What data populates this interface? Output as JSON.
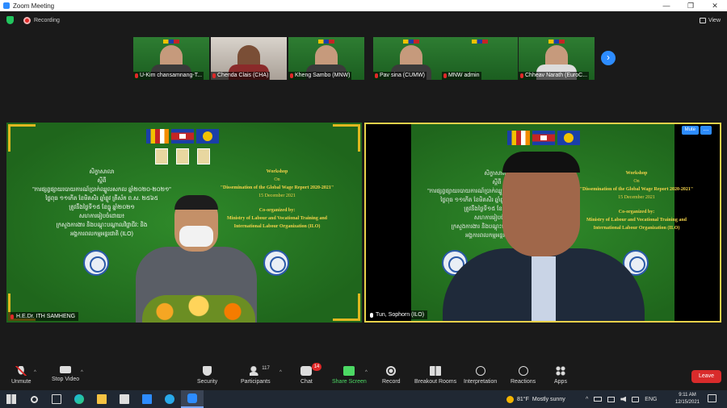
{
  "window": {
    "title": "Zoom Meeting",
    "controls": [
      "—",
      "❐",
      "✕"
    ]
  },
  "status": {
    "recording_label": "Recording",
    "view_label": "View"
  },
  "thumbnails": [
    {
      "name": "U-Kim chansamnang-T..."
    },
    {
      "name": "Chenda Clais (CHA)"
    },
    {
      "name": "Kheng Sambo (MNW)"
    },
    {
      "name": "Pav sina (CUMW)"
    },
    {
      "name": "MNW admin"
    },
    {
      "name": "Chheav Narath (EuroC..."
    }
  ],
  "next_page_arrow": "›",
  "slide": {
    "kh_lines": [
      "សិក្ខាសាលា",
      "ស្ដីពី",
      "\"ការផ្សព្វផ្សាយរបាយការណ៍ប្រាក់ឈ្នួលសកល ឆ្នាំ២០២០-២០២១\"",
      "ថ្ងៃពុធ ១១កើត ខែមិគសិរ ឆ្នាំឆ្លូវ ត្រីស័ក ព.ស. ២៥៦៥",
      "ត្រូវនឹងថ្ងៃទី១៥ ខែធ្នូ ឆ្នាំ២០២១",
      "សហការរៀបចំដោយ៖",
      "ក្រសួងការងារ និងបណ្តុះបណ្តាលវិជ្ជាជីវៈ និង",
      "អង្គការពលកម្មអន្តរជាតិ (ILO)"
    ],
    "eng_workshop": "Workshop",
    "eng_on": "On",
    "eng_title": "\"Dissemination of the Global Wage Report 2020-2021\"",
    "eng_date": "15 December 2021",
    "eng_coorg": "Co-organized by:",
    "eng_org1": "Ministry of Labour and Vocational Training and",
    "eng_org2": "International Labour Organization (ILO)"
  },
  "tiles": {
    "left_name": "H.E.Dr. ITH SAMHENG",
    "right_name": "Tun, Sophorn (ILO)",
    "mute_label": "Mute",
    "more_label": "..."
  },
  "toolbar": {
    "unmute": "Unmute",
    "stop_video": "Stop Video",
    "security": "Security",
    "participants": "Participants",
    "participants_count": "117",
    "chat": "Chat",
    "chat_badge": "14",
    "share_screen": "Share Screen",
    "record": "Record",
    "breakout_rooms": "Breakout Rooms",
    "interpretation": "Interpretation",
    "reactions": "Reactions",
    "apps": "Apps",
    "leave": "Leave"
  },
  "taskbar": {
    "temperature": "81°F",
    "weather": "Mostly sunny",
    "language": "ENG",
    "time": "9:11 AM",
    "date": "12/15/2021"
  },
  "colors": {
    "accent": "#2d8cff",
    "leave": "#d92b2b",
    "share": "#4cd964",
    "slide_green": "#23701f",
    "active_border": "#e8d14a"
  }
}
